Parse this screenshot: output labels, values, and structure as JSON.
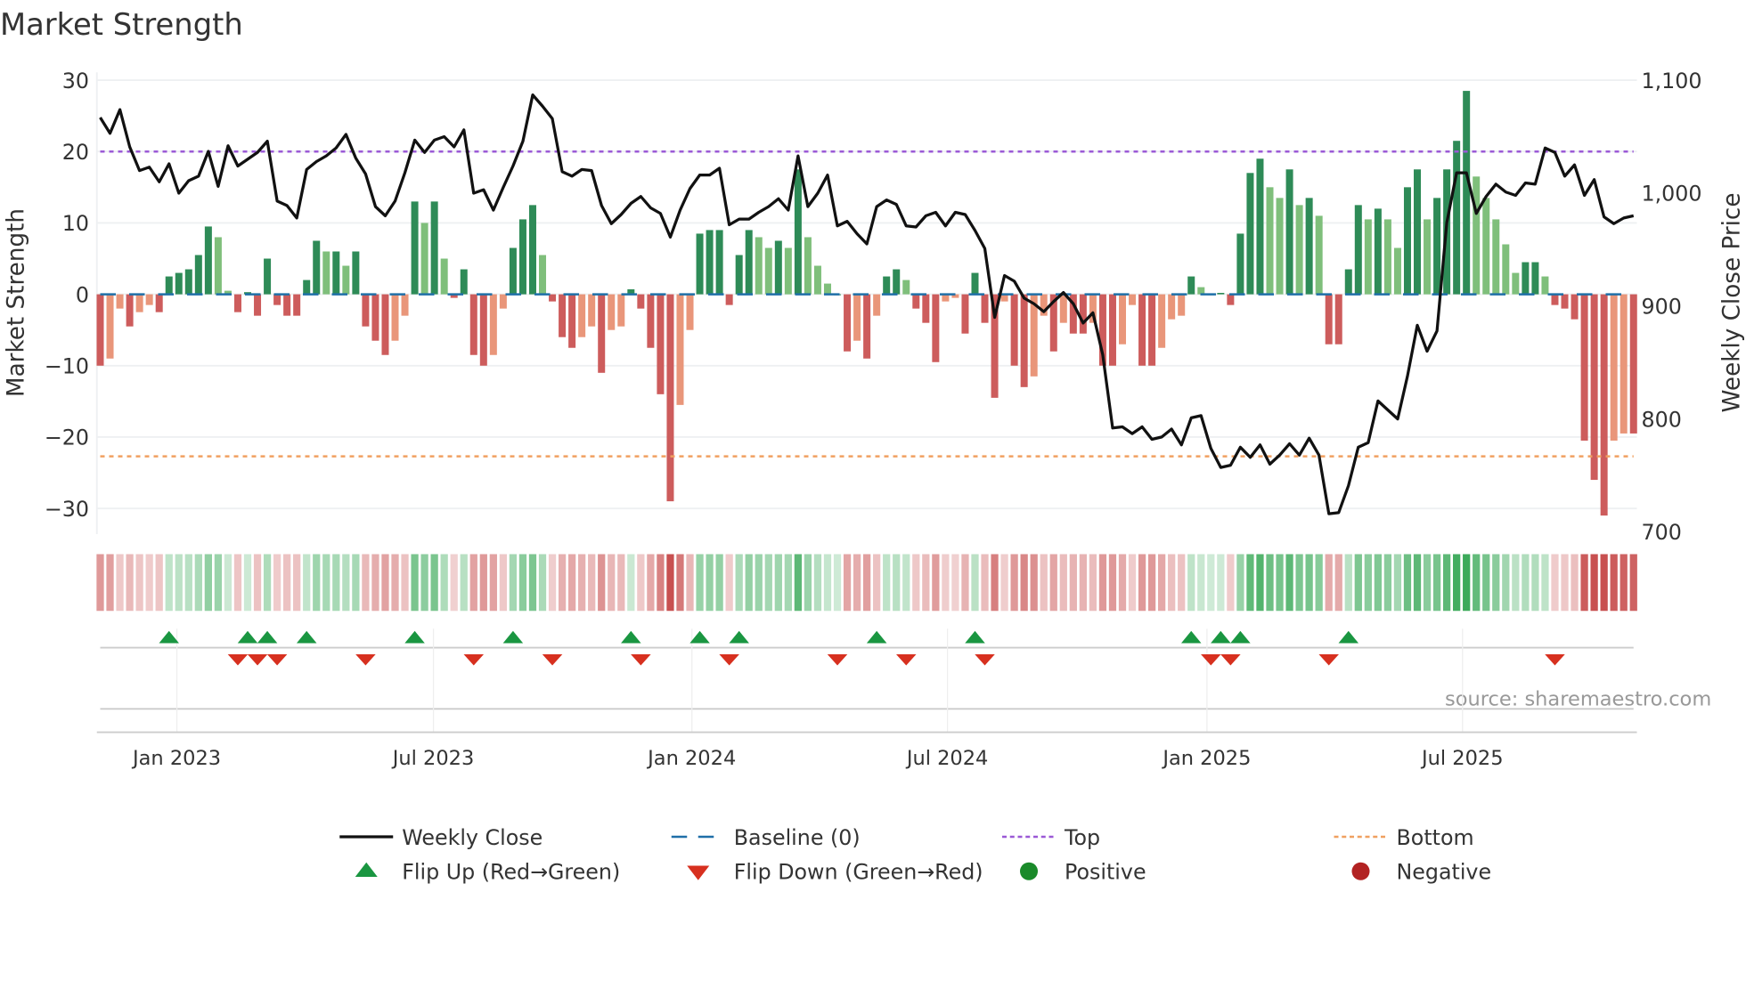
{
  "chart_data": {
    "type": "bar",
    "title": "Market Strength",
    "ylabel": "Market Strength",
    "y2label": "Weekly Close Price",
    "ylim": [
      -33.6,
      31.1
    ],
    "y2lim": [
      698,
      1107
    ],
    "yticks": [
      30,
      20,
      10,
      0,
      -10,
      -20,
      -30
    ],
    "ytick_labels": [
      "30",
      "20",
      "10",
      "0",
      "−10",
      "−20",
      "−30"
    ],
    "y2ticks": [
      1100,
      1000,
      900,
      800,
      700
    ],
    "y2tick_labels": [
      "1,100",
      "1,000",
      "900",
      "800",
      "700"
    ],
    "xticks": [
      {
        "week": 7.8,
        "label": "Jan 2023"
      },
      {
        "week": 33.9,
        "label": "Jul 2023"
      },
      {
        "week": 60.2,
        "label": "Jan 2024"
      },
      {
        "week": 86.2,
        "label": "Jul 2024"
      },
      {
        "week": 112.6,
        "label": "Jan 2025"
      },
      {
        "week": 138.6,
        "label": "Jul 2025"
      }
    ],
    "top_level": 20,
    "bottom_level": -22.7,
    "baseline": 0,
    "strength": [
      -10,
      -9,
      -2,
      -4.5,
      -2.5,
      -1.5,
      -2.5,
      2.5,
      3,
      3.5,
      5.5,
      9.5,
      8,
      0.5,
      -2.5,
      0.3,
      -3,
      5,
      -1.5,
      -3,
      -3,
      2,
      7.5,
      6,
      6,
      4,
      6,
      -4.5,
      -6.5,
      -8.5,
      -6.5,
      -3,
      13,
      10,
      13,
      5,
      -0.5,
      3.5,
      -8.5,
      -10,
      -8.5,
      -2,
      6.5,
      10.5,
      12.5,
      5.5,
      -1,
      -6,
      -7.5,
      -6,
      -4.5,
      -11,
      -5,
      -4.5,
      0.7,
      -2,
      -7.5,
      -14,
      -29,
      -15.5,
      -5,
      8.5,
      9,
      9,
      -1.5,
      5.5,
      9,
      8,
      6.5,
      7.5,
      6.5,
      17.5,
      8,
      4,
      1.5,
      0,
      -8,
      -6.5,
      -9,
      -3,
      2.5,
      3.5,
      2,
      -2,
      -4,
      -9.5,
      -1,
      -0.5,
      -5.5,
      3,
      -4,
      -14.5,
      -1,
      -10,
      -13,
      -11.5,
      -3,
      -8,
      -4,
      -5.5,
      -5.5,
      -4,
      -10,
      -10,
      -7,
      -1.5,
      -10,
      -10,
      -7.5,
      -3.5,
      -3,
      2.5,
      1,
      0,
      0.2,
      -1.5,
      8.5,
      17,
      19,
      15,
      13.5,
      17.5,
      12.5,
      13.5,
      11,
      -7,
      -7,
      3.5,
      12.5,
      10.5,
      12,
      10.5,
      6.5,
      15,
      17.5,
      10.5,
      13.5,
      17.5,
      21.5,
      28.5,
      16.5,
      13.5,
      10.5,
      7,
      3,
      4.5,
      4.5,
      2.5,
      -1.5,
      -2,
      -3.5,
      -20.5,
      -26,
      -31,
      -20.5,
      -19.5,
      -19.5
    ],
    "weekly_close": [
      1067,
      1053,
      1074,
      1041,
      1020,
      1023,
      1010,
      1026,
      1000,
      1011,
      1015,
      1037,
      1006,
      1042,
      1024,
      1030,
      1036,
      1046,
      993,
      989,
      978,
      1021,
      1028,
      1033,
      1040,
      1052,
      1031,
      1017,
      988,
      980,
      993,
      1018,
      1047,
      1036,
      1047,
      1050,
      1041,
      1056,
      1000,
      1003,
      985,
      1005,
      1024,
      1046,
      1087,
      1077,
      1066,
      1019,
      1015,
      1021,
      1020,
      989,
      973,
      981,
      991,
      997,
      987,
      982,
      961,
      985,
      1004,
      1016,
      1016,
      1022,
      972,
      977,
      977,
      983,
      988,
      995,
      985,
      1033,
      988,
      1000,
      1016,
      971,
      975,
      964,
      955,
      988,
      994,
      990,
      971,
      970,
      980,
      983,
      971,
      983,
      981,
      967,
      951,
      890,
      927,
      922,
      907,
      902,
      895,
      904,
      912,
      902,
      885,
      894,
      857,
      792,
      793,
      787,
      793,
      782,
      784,
      791,
      777,
      801,
      803,
      774,
      757,
      759,
      775,
      766,
      777,
      760,
      768,
      778,
      768,
      783,
      768,
      716,
      717,
      741,
      775,
      779,
      816,
      808,
      800,
      838,
      883,
      860,
      878,
      974,
      1018,
      1018,
      982,
      997,
      1008,
      1001,
      998,
      1009,
      1008,
      1040,
      1036,
      1015,
      1025,
      998,
      1012,
      979,
      973,
      978,
      980
    ],
    "flip_up_weeks": [
      7,
      15,
      17,
      21,
      32,
      42,
      54,
      61,
      65,
      79,
      89,
      111,
      114,
      116,
      127
    ],
    "flip_down_weeks": [
      14,
      16,
      18,
      27,
      38,
      46,
      55,
      64,
      75,
      82,
      90,
      113,
      115,
      125,
      148
    ],
    "legend": [
      {
        "label": "Weekly Close",
        "kind": "line",
        "color": "#111111"
      },
      {
        "label": "Baseline (0)",
        "kind": "dash",
        "color": "#1f6fa8"
      },
      {
        "label": "Top",
        "kind": "dot",
        "color": "#9b59d6"
      },
      {
        "label": "Bottom",
        "kind": "dot",
        "color": "#f0a060"
      },
      {
        "label": "Flip Up (Red→Green)",
        "kind": "tri-up",
        "color": "#1a9641"
      },
      {
        "label": "Flip Down (Green→Red)",
        "kind": "tri-down",
        "color": "#d7301f"
      },
      {
        "label": "Positive",
        "kind": "circle",
        "color": "#1a8a2a"
      },
      {
        "label": "Negative",
        "kind": "circle",
        "color": "#b22222"
      }
    ],
    "source": "source: sharemaestro.com",
    "colors": {
      "pos_strong": "#2e8b57",
      "pos_weak": "#7fbf7b",
      "neg_strong": "#cd5c5c",
      "neg_weak": "#e9967a"
    }
  }
}
